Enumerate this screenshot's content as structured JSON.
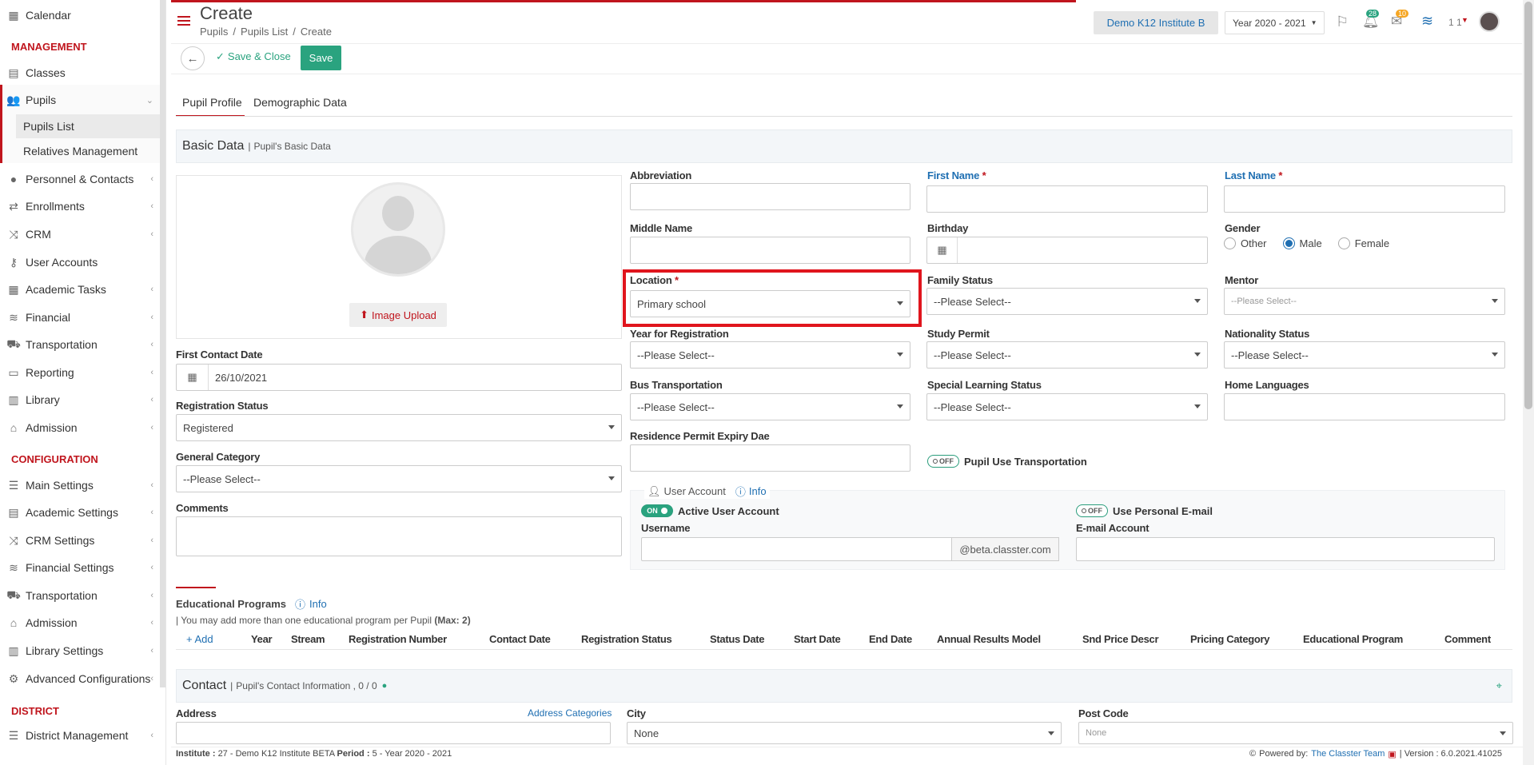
{
  "sidebar": {
    "items": [
      {
        "label": "Calendar",
        "icon": "calendar-icon"
      },
      {
        "label": "Classes",
        "icon": "classes-icon"
      },
      {
        "label": "Pupils",
        "icon": "users-icon"
      },
      {
        "label": "Personnel & Contacts",
        "icon": "person-icon"
      },
      {
        "label": "Enrollments",
        "icon": "arrows-icon"
      },
      {
        "label": "CRM",
        "icon": "crm-icon"
      },
      {
        "label": "User Accounts",
        "icon": "key-icon"
      },
      {
        "label": "Academic Tasks",
        "icon": "grid-icon"
      },
      {
        "label": "Financial",
        "icon": "coins-icon"
      },
      {
        "label": "Transportation",
        "icon": "bus-icon"
      },
      {
        "label": "Reporting",
        "icon": "printer-icon"
      },
      {
        "label": "Library",
        "icon": "books-icon"
      },
      {
        "label": "Admission",
        "icon": "building-icon"
      }
    ],
    "management_heading": "MANAGEMENT",
    "configuration_heading": "CONFIGURATION",
    "district_heading": "DISTRICT",
    "pupils_sub": [
      "Pupils List",
      "Relatives Management"
    ],
    "config_items": [
      {
        "label": "Main Settings",
        "icon": "sliders-icon"
      },
      {
        "label": "Academic Settings",
        "icon": "classes-icon"
      },
      {
        "label": "CRM Settings",
        "icon": "crm-icon"
      },
      {
        "label": "Financial Settings",
        "icon": "coins-icon"
      },
      {
        "label": "Transportation",
        "icon": "bus-icon"
      },
      {
        "label": "Admission",
        "icon": "building-icon"
      },
      {
        "label": "Library Settings",
        "icon": "books-icon"
      },
      {
        "label": "Advanced Configurations",
        "icon": "gears-icon"
      }
    ],
    "district_items": [
      {
        "label": "District Management",
        "icon": "list-icon"
      }
    ]
  },
  "header": {
    "title": "Create",
    "breadcrumb": [
      "Pupils",
      "Pupils List",
      "Create"
    ],
    "institute": "Demo K12 Institute B",
    "year": "Year 2020 - 2021",
    "notif_count": "28",
    "mail_count": "10",
    "user_short": "1 1"
  },
  "toolbar": {
    "save_close": "Save & Close",
    "save": "Save"
  },
  "tabs": [
    "Pupil Profile",
    "Demographic Data"
  ],
  "basic": {
    "title": "Basic Data",
    "subtitle": "Pupil's Basic Data",
    "image_upload": "Image Upload",
    "first_contact_label": "First Contact Date",
    "first_contact_value": "26/10/2021",
    "reg_status_label": "Registration Status",
    "reg_status_value": "Registered",
    "gen_cat_label": "General Category",
    "gen_cat_value": "--Please Select--",
    "comments_label": "Comments",
    "abbreviation_label": "Abbreviation",
    "first_name_label": "First Name",
    "last_name_label": "Last Name",
    "middle_name_label": "Middle Name",
    "birthday_label": "Birthday",
    "gender_label": "Gender",
    "gender_options": [
      "Other",
      "Male",
      "Female"
    ],
    "gender_selected": "Male",
    "location_label": "Location",
    "location_value": "Primary school",
    "family_status_label": "Family Status",
    "family_status_value": "--Please Select--",
    "mentor_label": "Mentor",
    "mentor_value": "--Please Select--",
    "year_reg_label": "Year for Registration",
    "year_reg_value": "--Please Select--",
    "study_permit_label": "Study Permit",
    "study_permit_value": "--Please Select--",
    "nationality_label": "Nationality Status",
    "nationality_value": "--Please Select--",
    "bus_label": "Bus Transportation",
    "bus_value": "--Please Select--",
    "special_label": "Special Learning Status",
    "special_value": "--Please Select--",
    "home_lang_label": "Home Languages",
    "residence_label": "Residence Permit Expiry Dae",
    "pupil_transport_label": "Pupil Use Transportation",
    "toggle_off": "OFF",
    "toggle_on": "ON"
  },
  "user_account": {
    "title": "User Account",
    "info": "Info",
    "active_label": "Active User Account",
    "personal_email_label": "Use Personal E-mail",
    "username_label": "Username",
    "domain": "@beta.classter.com",
    "email_label": "E-mail Account"
  },
  "programs": {
    "title": "Educational Programs",
    "info": "Info",
    "note": "| You may add more than one educational program per Pupil",
    "note_max": "(Max: 2)",
    "add": "+ Add",
    "columns": [
      "Year",
      "Stream",
      "Registration Number",
      "Contact Date",
      "Registration Status",
      "Status Date",
      "Start Date",
      "End Date",
      "Annual Results Model",
      "Snd Price Descr",
      "Pricing Category",
      "Educational Program",
      "Comment"
    ]
  },
  "contact": {
    "title": "Contact",
    "subtitle": "Pupil's Contact Information , 0 / 0",
    "address_label": "Address",
    "address_categories": "Address Categories",
    "city_label": "City",
    "city_value": "None",
    "post_code_label": "Post Code",
    "post_code_value": "None"
  },
  "footer": {
    "institute_label": "Institute :",
    "institute_value": "27 - Demo K12 Institute BETA",
    "period_label": "Period :",
    "period_value": "5 - Year 2020 - 2021",
    "powered": "Powered by:",
    "team": "The Classter Team",
    "version": "| Version : 6.0.2021.41025"
  },
  "colors": {
    "accent": "#c0151d",
    "primary": "#2aa37f",
    "link": "#1f6fb2"
  }
}
